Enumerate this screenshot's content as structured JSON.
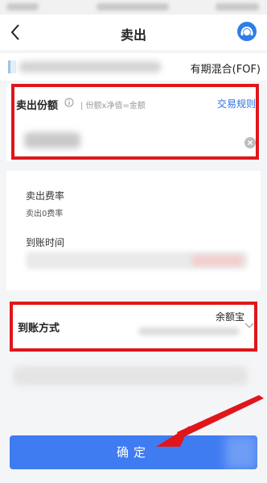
{
  "header": {
    "title": "卖出",
    "back_icon": "chevron-left-icon",
    "service_icon": "customer-service-icon"
  },
  "fund": {
    "name_suffix": "有期混合(FOF)"
  },
  "sell_card": {
    "label": "卖出份额",
    "hint": "份额x净值=金额",
    "rule_link": "交易规则"
  },
  "fee_card": {
    "fee_label": "卖出费率",
    "fee_value": "卖出0费率",
    "arrival_label": "到账时间"
  },
  "method_card": {
    "label": "到账方式",
    "value": "余额宝"
  },
  "confirm_button": {
    "label": "确定"
  },
  "colors": {
    "accent": "#3f7cf2",
    "link": "#2a6fe2",
    "highlight": "#e0161b"
  }
}
